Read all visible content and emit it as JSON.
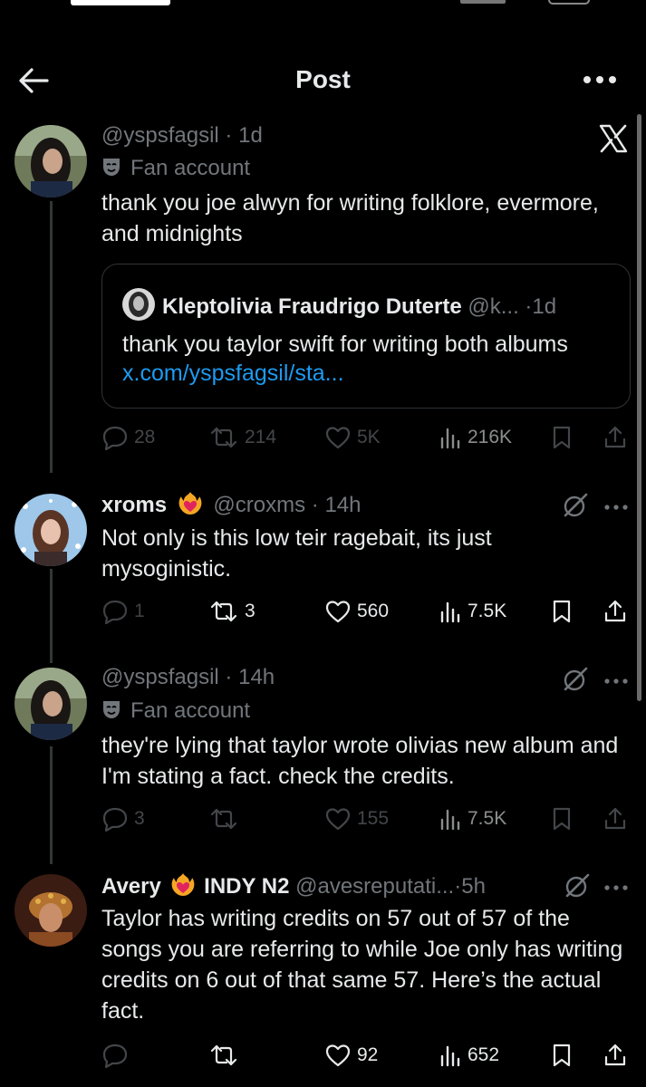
{
  "header": {
    "title": "Post"
  },
  "posts": [
    {
      "handle": "@yspsfagsil",
      "time": "1d",
      "badge": "Fan account",
      "text": "thank you joe alwyn for writing folklore, evermore, and midnights",
      "quote": {
        "name": "Kleptolivia Fraudrigo Duterte",
        "handle": "@k...",
        "time": "1d",
        "text": "thank you taylor swift for writing both albums",
        "link": "x.com/yspsfagsil/sta..."
      },
      "replies": "28",
      "reposts": "214",
      "likes": "5K",
      "views": "216K"
    },
    {
      "name": "xroms",
      "handle": "@croxms",
      "time": "14h",
      "text": "Not only is this low teir ragebait, its just mysoginistic.",
      "replies": "1",
      "reposts": "3",
      "likes": "560",
      "views": "7.5K"
    },
    {
      "handle": "@yspsfagsil",
      "time": "14h",
      "badge": "Fan account",
      "text": "they're lying that taylor wrote olivias new album and I'm stating a fact. check the credits.",
      "replies": "3",
      "reposts": "",
      "likes": "155",
      "views": "7.5K"
    },
    {
      "name": "Avery",
      "name_suffix": "INDY N2",
      "handle": "@avesreputati...",
      "time": "5h",
      "text": "Taylor has writing credits on 57 out of 57 of the songs you are referring to while Joe only has writing credits on 6 out of that same 57. Here’s the actual fact.",
      "replies": "",
      "reposts": "",
      "likes": "92",
      "views": "652"
    }
  ],
  "sep": "·",
  "colors": {
    "muted": "#71767b",
    "text": "#e7e9ea",
    "link": "#1d9bf0",
    "heart": "#f91880"
  }
}
